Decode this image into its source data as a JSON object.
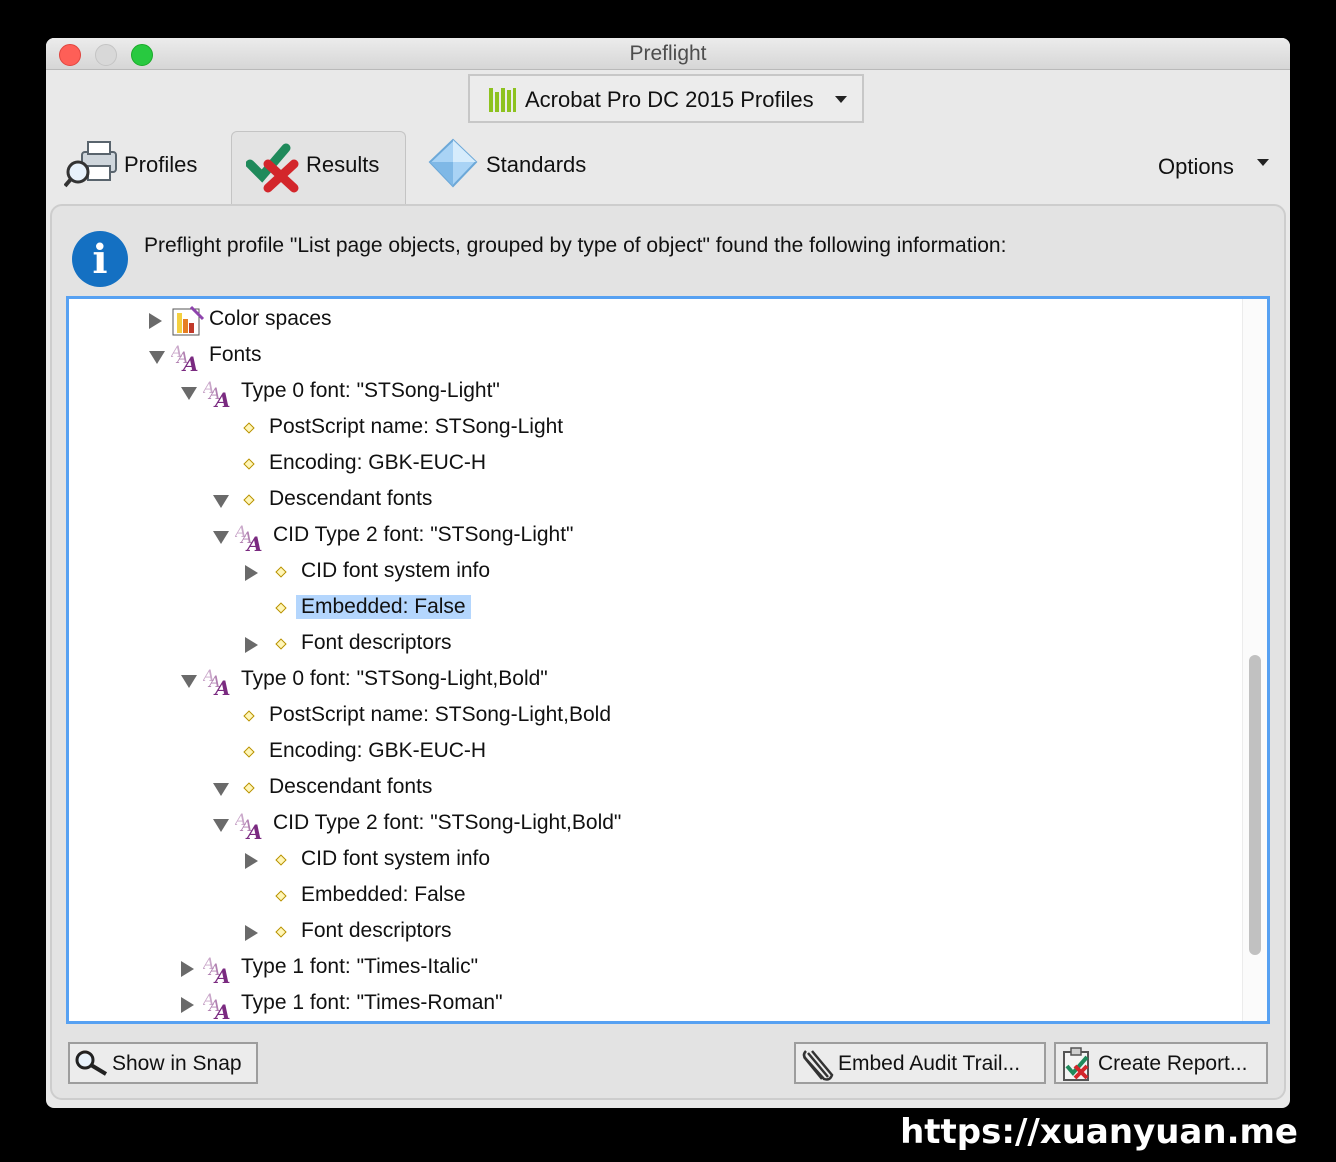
{
  "window": {
    "title": "Preflight"
  },
  "profile_selector": {
    "label": "Acrobat Pro DC 2015 Profiles"
  },
  "tabs": [
    {
      "label": "Profiles",
      "icon": "printer-magnifier-icon"
    },
    {
      "label": "Results",
      "icon": "check-cross-icon",
      "selected": true
    },
    {
      "label": "Standards",
      "icon": "diamond-icon"
    }
  ],
  "options": {
    "label": "Options"
  },
  "info": {
    "text": "Preflight profile \"List page objects, grouped by type of object\" found the following information:"
  },
  "tree": [
    {
      "label": "Color spaces"
    },
    {
      "label": "Fonts"
    },
    {
      "label": "Type 0 font: \"STSong-Light\""
    },
    {
      "label": "PostScript name: STSong-Light"
    },
    {
      "label": "Encoding: GBK-EUC-H"
    },
    {
      "label": "Descendant fonts"
    },
    {
      "label": "CID Type 2 font: \"STSong-Light\""
    },
    {
      "label": "CID font system info"
    },
    {
      "label": "Embedded: False"
    },
    {
      "label": "Font descriptors"
    },
    {
      "label": "Type 0 font: \"STSong-Light,Bold\""
    },
    {
      "label": "PostScript name: STSong-Light,Bold"
    },
    {
      "label": "Encoding: GBK-EUC-H"
    },
    {
      "label": "Descendant fonts"
    },
    {
      "label": "CID Type 2 font: \"STSong-Light,Bold\""
    },
    {
      "label": "CID font system info"
    },
    {
      "label": "Embedded: False"
    },
    {
      "label": "Font descriptors"
    },
    {
      "label": "Type 1 font: \"Times-Italic\""
    },
    {
      "label": "Type 1 font: \"Times-Roman\""
    }
  ],
  "buttons": {
    "show_in_snap": "Show in Snap",
    "embed_audit_trail": "Embed Audit Trail...",
    "create_report": "Create Report..."
  },
  "watermark": "https://xuanyuan.me",
  "colors": {
    "accent": "#57a1f2",
    "selection": "#b4d6fd",
    "info": "#1470c2"
  }
}
